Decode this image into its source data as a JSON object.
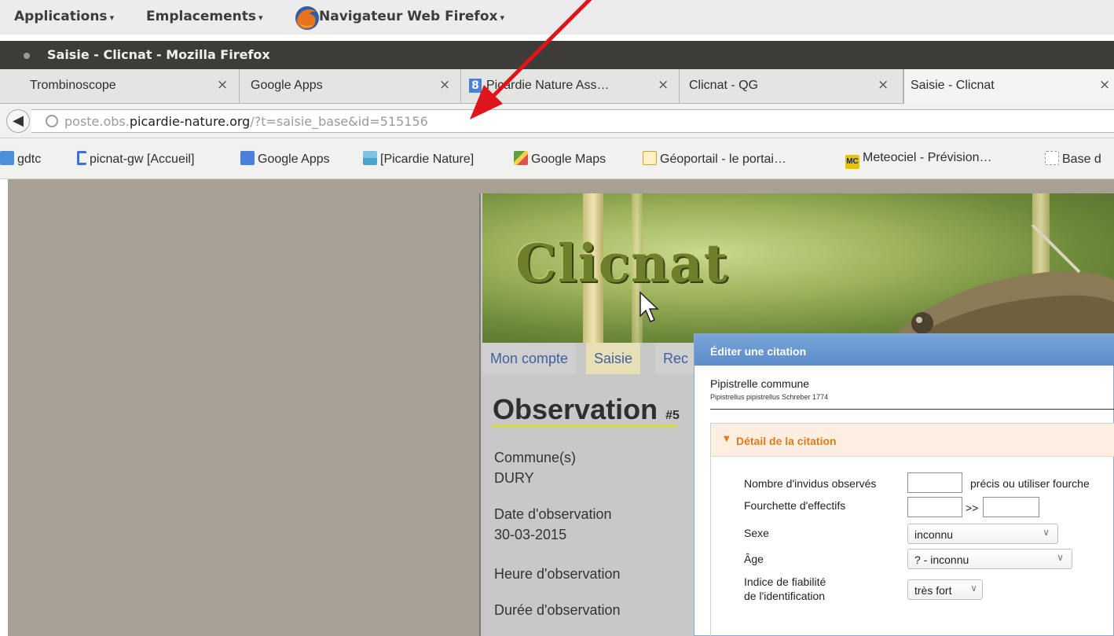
{
  "top_panel": {
    "applications_menu": "Applications",
    "places_menu": "Emplacements",
    "app_menu": "Navigateur Web Firefox"
  },
  "window": {
    "title": "Saisie - Clicnat - Mozilla Firefox"
  },
  "tabs": [
    {
      "label": "Trombinoscope",
      "close": "×"
    },
    {
      "label": "Google Apps",
      "close": "×"
    },
    {
      "label": "Picardie Nature Ass…",
      "close": "×"
    },
    {
      "label": "Clicnat - QG",
      "close": "×"
    },
    {
      "label": "Saisie - Clicnat",
      "close": "×"
    }
  ],
  "url": {
    "prefix": "poste.obs.",
    "host": "picardie-nature.org",
    "path": "/?t=saisie_base&id=515156"
  },
  "bookmarks": [
    {
      "label": "gdtc",
      "icon": "monitor-icon",
      "color": "#4a90d9"
    },
    {
      "label": "picnat-gw [Accueil]",
      "icon": "bracket-icon",
      "color": "#3a6fe0"
    },
    {
      "label": "Google Apps",
      "icon": "google-apps-icon",
      "color": "#4a80d9"
    },
    {
      "label": "[Picardie Nature]",
      "icon": "landscape-icon",
      "color": "#4aa3c9"
    },
    {
      "label": "Google Maps",
      "icon": "maps-icon",
      "color": "#5fa043"
    },
    {
      "label": "Géoportail - le portai…",
      "icon": "geoportail-icon",
      "color": "#e0a020"
    },
    {
      "label": "Meteociel - Prévision…",
      "icon": "mc-icon",
      "color": "#e8c400"
    },
    {
      "label": "Base d",
      "icon": "blank-page-icon",
      "color": "#cccccc"
    }
  ],
  "site": {
    "logo": "Clicnat",
    "nav": [
      "Mon compte",
      "Saisie",
      "Rec"
    ],
    "page_title": "Observation",
    "page_title_suffix": "#5",
    "fields": [
      {
        "label": "Commune(s)",
        "value": "DURY"
      },
      {
        "label": "Date d'observation",
        "value": "30-03-2015"
      },
      {
        "label": "Heure d'observation",
        "value": ""
      },
      {
        "label": "Durée d'observation",
        "value": ""
      }
    ]
  },
  "dialog": {
    "title": "Éditer une citation",
    "species_common": "Pipistrelle commune",
    "species_scientific": "Pipistrellus pipistrellus Schreber 1774",
    "section_title": "Détail de la citation",
    "count_label": "Nombre d'invidus observés",
    "count_value": "",
    "count_hint": "précis ou utiliser fourche",
    "range_label": "Fourchette d'effectifs",
    "range_sep": ">>",
    "range_min": "",
    "range_max": "",
    "sex_label": "Sexe",
    "sex_value": "inconnu",
    "age_label": "Âge",
    "age_value": "? - inconnu",
    "reliability_label_1": "Indice de fiabilité",
    "reliability_label_2": "de l'identification",
    "reliability_value": "très fort"
  },
  "colors": {
    "annotation_arrow": "#e0141b",
    "dialog_header": "#6b98d1",
    "section_accent": "#e07a1b",
    "page_background": "#a6a194"
  }
}
